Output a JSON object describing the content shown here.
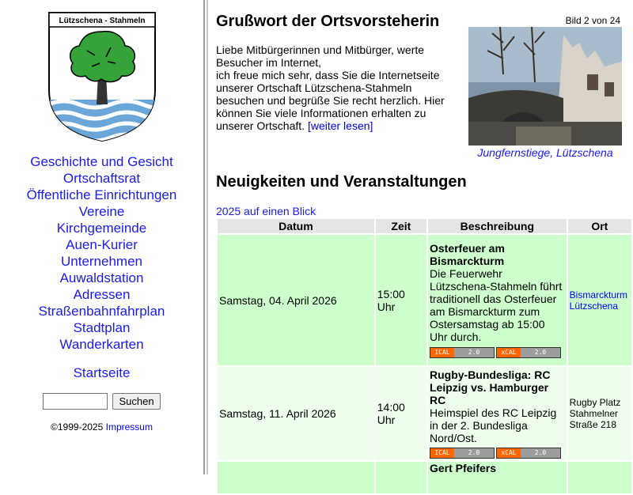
{
  "sidebar": {
    "crest_text": "Lützschena - Stahmeln",
    "nav": [
      "Geschichte und Gesicht",
      "Ortschaftsrat",
      "Öffentliche Einrichtungen",
      "Vereine",
      "Kirchgemeinde",
      "Auen-Kurier",
      "Unternehmen",
      "Auwaldstation",
      "Adressen",
      "Straßenbahnfahrplan",
      "Stadtplan",
      "Wanderkarten"
    ],
    "home": "Startseite",
    "search_button": "Suchen",
    "search_value": "",
    "copyright": "©1999-2025",
    "impressum": "Impressum"
  },
  "main": {
    "greeting_title": "Grußwort der Ortsvorsteherin",
    "intro_line1": "Liebe Mitbürgerinnen und Mitbürger, werte Besucher im Internet,",
    "intro_line2": "ich freue mich sehr, dass Sie die Internetseite unserer Ortschaft Lützschena-Stahmeln besuchen und begrüße Sie recht herzlich. Hier können Sie viele Informationen erhalten zu unserer Ortschaft.",
    "intro_link": "[weiter lesen]",
    "photo_counter": "Bild 2 von 24",
    "photo_caption": "Jungfernstiege, Lützschena",
    "news_title": "Neuigkeiten und Veranstaltungen",
    "year_link": "2025 auf einen Blick",
    "table_headers": {
      "datum": "Datum",
      "zeit": "Zeit",
      "beschreibung": "Beschreibung",
      "ort": "Ort"
    },
    "badges": {
      "ical": "ICAL",
      "xcal": "xCAL",
      "version": "2.0"
    },
    "events": [
      {
        "datum": "Samstag, 04. April 2026",
        "zeit": "15:00 Uhr",
        "title": "Osterfeuer am Bismarckturm",
        "text": "Die Feuerwehr Lützschena-Stahmeln führt traditionell das Osterfeuer am Bismarckturm zum Ostersamstag ab 15:00 Uhr durch.",
        "ort_line1": "Bismarckturm",
        "ort_line2": "Lützschena"
      },
      {
        "datum": "Samstag, 11. April 2026",
        "zeit": "14:00 Uhr",
        "title": "Rugby-Bundesliga: RC Leipzig vs. Hamburger RC",
        "text": "Heimspiel des RC Leipzig in der 2. Bundesliga Nord/Ost.",
        "ort_line1": "Rugby Platz",
        "ort_line2": "Stahmelner Straße 218"
      },
      {
        "datum": "",
        "zeit": "",
        "title": "Gert Pfeifers",
        "text": "",
        "ort_line1": "",
        "ort_line2": ""
      }
    ]
  },
  "colors": {
    "link": "#1a1aee",
    "row_green": "#ccffcc",
    "row_light": "#eeffee",
    "header_gray": "#e5e5e5",
    "badge_orange": "#ff6600"
  }
}
